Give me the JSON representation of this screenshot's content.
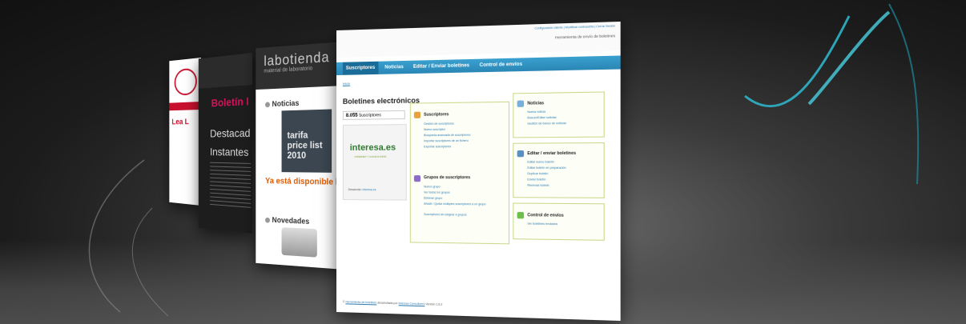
{
  "card1": {
    "heading": "Lea L"
  },
  "card2": {
    "title": "Boletín I",
    "line1": "Destacad",
    "line2": "Instantes"
  },
  "card3": {
    "logo": "labotienda",
    "subtitle": "material de laboratorio",
    "noticias": "Noticias",
    "price_list": "tarifa price list 2010",
    "headline": "Ya está disponible la t",
    "novedades": "Novedades"
  },
  "app": {
    "top_links": "Configuración cliente | Modificar contraseña | Cerrar Sesión",
    "tool_name": "Herramienta de envío de boletines",
    "tabs": [
      "Suscriptores",
      "Noticias",
      "Editar / Enviar boletines",
      "Control de envíos"
    ],
    "breadcrumb": "Inicio",
    "page_title": "Boletines electrónicos",
    "subscriber_count": "8.055",
    "subscriber_label": "Suscriptores",
    "brand_logo": "interesa.es",
    "brand_slogan": "INTERNET Y CONSULTORÍA",
    "developed_label": "Desarrollo:",
    "developed_link": "interesa.es",
    "suscriptores": {
      "title": "Suscriptores",
      "links": [
        "Gestión de suscriptores",
        "Nuevo suscriptor",
        "Búsqueda avanzada de suscriptores",
        "Importar suscriptores de un fichero",
        "Exportar suscriptores"
      ]
    },
    "grupos": {
      "title": "Grupos de suscriptores",
      "links": [
        "Nuevo grupo",
        "Ver todos los grupos",
        "Eliminar grupo",
        "Añadir / Quitar múltiples suscriptores a un grupo",
        "Suscriptores sin asignar a grupos"
      ]
    },
    "noticias": {
      "title": "Noticias",
      "links": [
        "Nueva noticia",
        "Buscar/Editar noticias",
        "Gestión de banco de noticias"
      ]
    },
    "editar": {
      "title": "Editar / enviar boletines",
      "links": [
        "Editar nuevo boletín",
        "Editar boletín en preparación",
        "Duplicar boletín",
        "Enviar boletín",
        "Reenviar boletín"
      ]
    },
    "control": {
      "title": "Control de envíos",
      "links": [
        "Ver boletines enviados"
      ]
    },
    "footer_prefix": "©",
    "footer_link1": "Herramienta de boletines",
    "footer_mid": "desarrollada por",
    "footer_link2": "Interesa Consultores",
    "footer_version": "Versión 1.5.0"
  }
}
